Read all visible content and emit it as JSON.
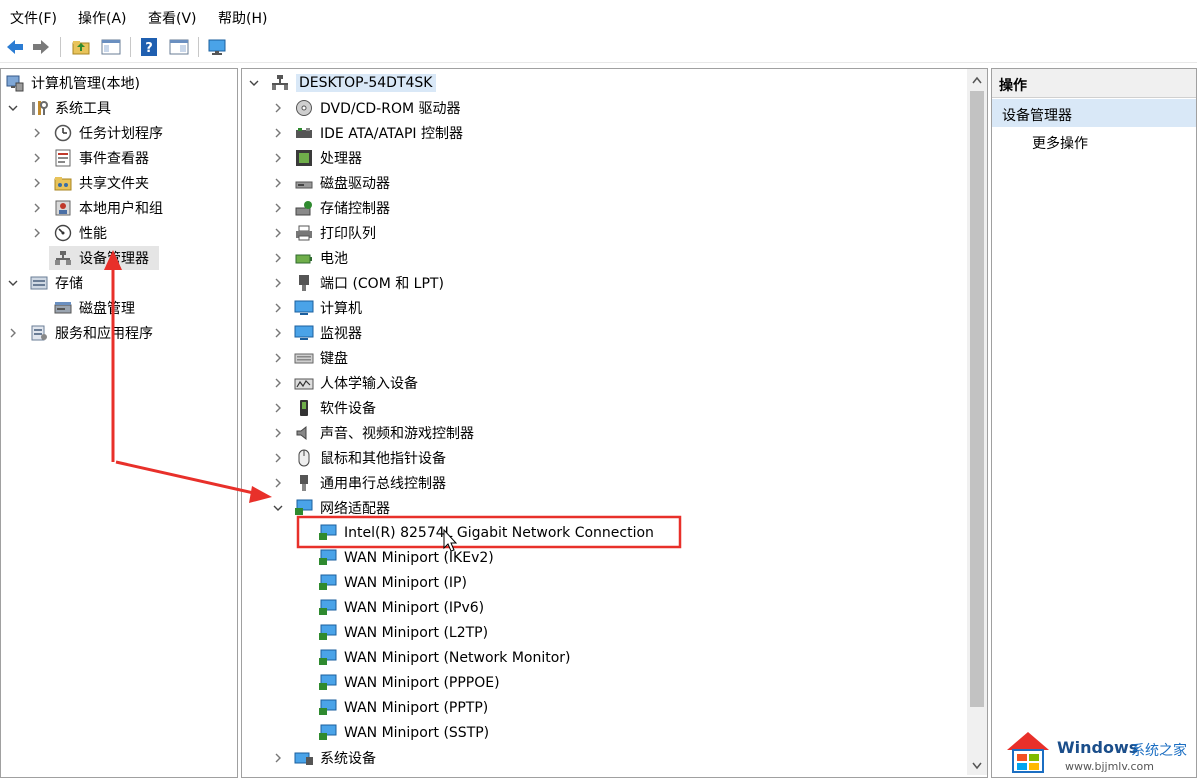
{
  "menubar": {
    "items": [
      "文件(F)",
      "操作(A)",
      "查看(V)",
      "帮助(H)"
    ]
  },
  "toolbar": {
    "buttons": [
      "back-icon",
      "forward-icon",
      "up-folder-icon",
      "show-hide-tree-icon",
      "help-icon",
      "properties-view-icon",
      "monitor-icon"
    ]
  },
  "tree": {
    "root": "计算机管理(本地)",
    "system_tools": "系统工具",
    "task_scheduler": "任务计划程序",
    "event_viewer": "事件查看器",
    "shared_folders": "共享文件夹",
    "local_users": "本地用户和组",
    "performance": "性能",
    "device_manager": "设备管理器",
    "storage": "存储",
    "disk_management": "磁盘管理",
    "services_apps": "服务和应用程序"
  },
  "devices": {
    "computer_name": "DESKTOP-54DT4SK",
    "categories": [
      "DVD/CD-ROM 驱动器",
      "IDE ATA/ATAPI 控制器",
      "处理器",
      "磁盘驱动器",
      "存储控制器",
      "打印队列",
      "电池",
      "端口 (COM 和 LPT)",
      "计算机",
      "监视器",
      "键盘",
      "人体学输入设备",
      "软件设备",
      "声音、视频和游戏控制器",
      "鼠标和其他指针设备",
      "通用串行总线控制器",
      "网络适配器"
    ],
    "network_adapters": [
      "Intel(R) 82574L Gigabit Network Connection",
      "WAN Miniport (IKEv2)",
      "WAN Miniport (IP)",
      "WAN Miniport (IPv6)",
      "WAN Miniport (L2TP)",
      "WAN Miniport (Network Monitor)",
      "WAN Miniport (PPPOE)",
      "WAN Miniport (PPTP)",
      "WAN Miniport (SSTP)"
    ],
    "last_category": "系统设备"
  },
  "actions": {
    "header": "操作",
    "selected": "设备管理器",
    "more": "更多操作"
  },
  "watermark": {
    "brand": "Windows",
    "cn": "系统之家",
    "url": "www.bjjmlv.com"
  },
  "colors": {
    "annotation_red": "#e8302a",
    "selection_blue": "#d9e8f7",
    "tree_selection": "#e5e5e5"
  }
}
